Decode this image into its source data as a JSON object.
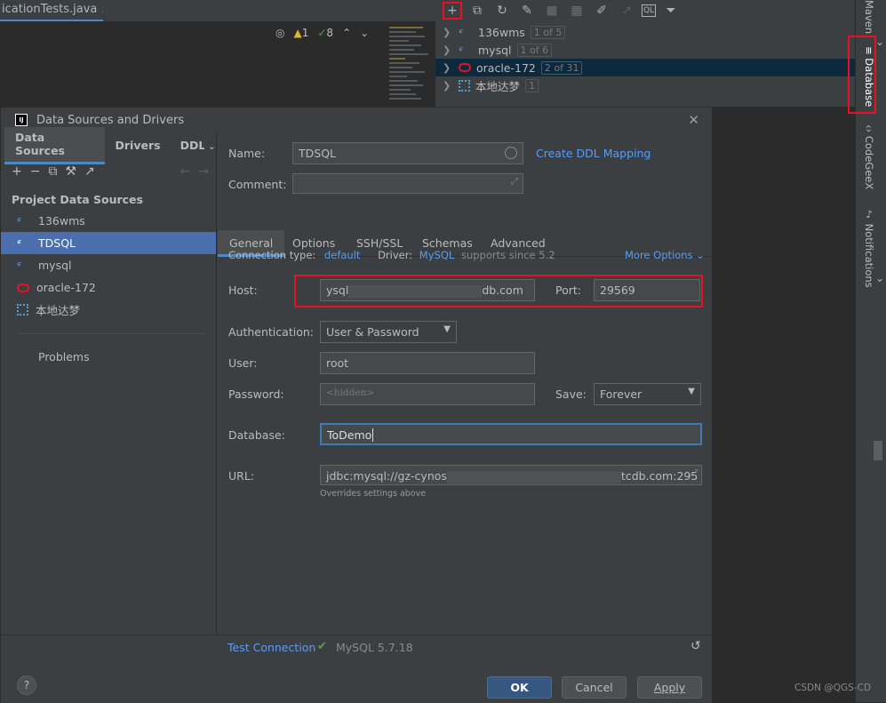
{
  "editor": {
    "tab_title": "icationTests.java",
    "tab_close": "×",
    "warnings": "1",
    "checks": "8"
  },
  "db_toolbar": {
    "icons": [
      "plus-icon",
      "copy-icon",
      "refresh-icon",
      "edit-schema-icon",
      "stop-icon",
      "table-icon",
      "pencil-icon",
      "jump-icon",
      "console-icon",
      "filter-icon"
    ]
  },
  "db_tree": [
    {
      "name": "136wms",
      "badge": "1 of 5",
      "icon": "mysql-icon"
    },
    {
      "name": "mysql",
      "badge": "1 of 6",
      "icon": "mysql-icon"
    },
    {
      "name": "oracle-172",
      "badge": "2 of 31",
      "icon": "oracle-icon",
      "selected": true
    },
    {
      "name": "本地达梦",
      "badge": "1",
      "icon": "local-db-icon"
    }
  ],
  "right_strip": {
    "maven": "Maven",
    "database": "Database",
    "codegeex": "CodeGeeX",
    "notifications": "Notifications"
  },
  "dialog": {
    "title": "Data Sources and Drivers",
    "close": "✕",
    "left_tabs": [
      "Data Sources",
      "Drivers",
      "DDL"
    ],
    "project_label": "Project Data Sources",
    "sources": [
      {
        "name": "136wms",
        "icon": "mysql-icon"
      },
      {
        "name": "TDSQL",
        "icon": "mysql-icon",
        "selected": true
      },
      {
        "name": "mysql",
        "icon": "mysql-icon"
      },
      {
        "name": "oracle-172",
        "icon": "oracle-icon"
      },
      {
        "name": "本地达梦",
        "icon": "local-db-icon"
      }
    ],
    "problems": "Problems",
    "name_label": "Name:",
    "name_value": "TDSQL",
    "comment_label": "Comment:",
    "ddl_link": "Create DDL Mapping",
    "tabs": [
      "General",
      "Options",
      "SSH/SSL",
      "Schemas",
      "Advanced"
    ],
    "connection_type_label": "Connection type:",
    "connection_type_value": "default",
    "driver_label": "Driver:",
    "driver_value": "MySQL",
    "driver_note": "supports since 5.2",
    "more_options": "More Options",
    "host_label": "Host:",
    "host_prefix": "ysql",
    "host_suffix": "db.com",
    "port_label": "Port:",
    "port_value": "29569",
    "auth_label": "Authentication:",
    "auth_value": "User & Password",
    "user_label": "User:",
    "user_value": "root",
    "password_label": "Password:",
    "password_placeholder": "<hidden>",
    "save_label": "Save:",
    "save_value": "Forever",
    "database_label": "Database:",
    "database_value": "ToDemo",
    "url_label": "URL:",
    "url_prefix": "jdbc:mysql://gz-cynos",
    "url_suffix": "tcdb.com:295",
    "url_note": "Overrides settings above",
    "test_connection": "Test Connection",
    "test_result": "MySQL 5.7.18",
    "help": "?",
    "ok": "OK",
    "cancel": "Cancel",
    "apply": "Apply"
  },
  "watermark": "CSDN @QGS-CD"
}
